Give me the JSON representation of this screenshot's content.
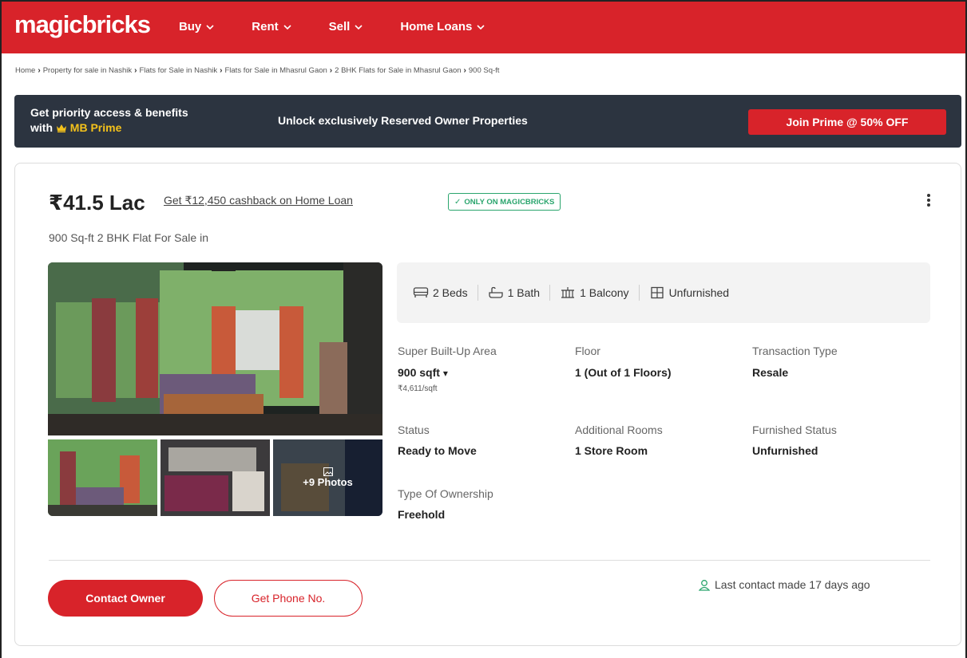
{
  "header": {
    "logo": "magicbricks",
    "nav": [
      {
        "label": "Buy"
      },
      {
        "label": "Rent"
      },
      {
        "label": "Sell"
      },
      {
        "label": "Home Loans"
      }
    ]
  },
  "breadcrumb": [
    "Home",
    "Property for sale in Nashik",
    "Flats for Sale in Nashik",
    "Flats for Sale in Mhasrul Gaon",
    "2 BHK Flats for Sale in Mhasrul Gaon",
    "900 Sq-ft"
  ],
  "prime_banner": {
    "line1": "Get priority access & benefits",
    "line2_prefix": "with ",
    "line2_brand": "MB Prime",
    "middle": "Unlock exclusively Reserved Owner Properties",
    "button": "Join Prime @ 50% OFF"
  },
  "listing": {
    "price": "₹41.5 Lac",
    "cashback": "Get ₹12,450 cashback on Home Loan",
    "badge": "ONLY ON MAGICBRICKS",
    "subtitle": "900 Sq-ft 2 BHK Flat For Sale in",
    "more_photos": "+9 Photos",
    "summary": {
      "beds": "2 Beds",
      "bath": "1 Bath",
      "balcony": "1 Balcony",
      "furnishing": "Unfurnished"
    },
    "details": {
      "area_label": "Super Built-Up Area",
      "area_value": "900 sqft",
      "area_price": "₹4,611/sqft",
      "floor_label": "Floor",
      "floor_value": "1 (Out of 1 Floors)",
      "transaction_label": "Transaction Type",
      "transaction_value": "Resale",
      "status_label": "Status",
      "status_value": "Ready to Move",
      "rooms_label": "Additional Rooms",
      "rooms_value": "1 Store Room",
      "furnished_label": "Furnished Status",
      "furnished_value": "Unfurnished",
      "ownership_label": "Type Of Ownership",
      "ownership_value": "Freehold"
    },
    "contact_button": "Contact Owner",
    "phone_button": "Get Phone No.",
    "last_contact": "Last contact made 17 days ago"
  },
  "colors": {
    "brand_red": "#d8232a",
    "banner_dark": "#2c3440",
    "prime_gold": "#f3c11b",
    "verified_green": "#2aa56d"
  }
}
